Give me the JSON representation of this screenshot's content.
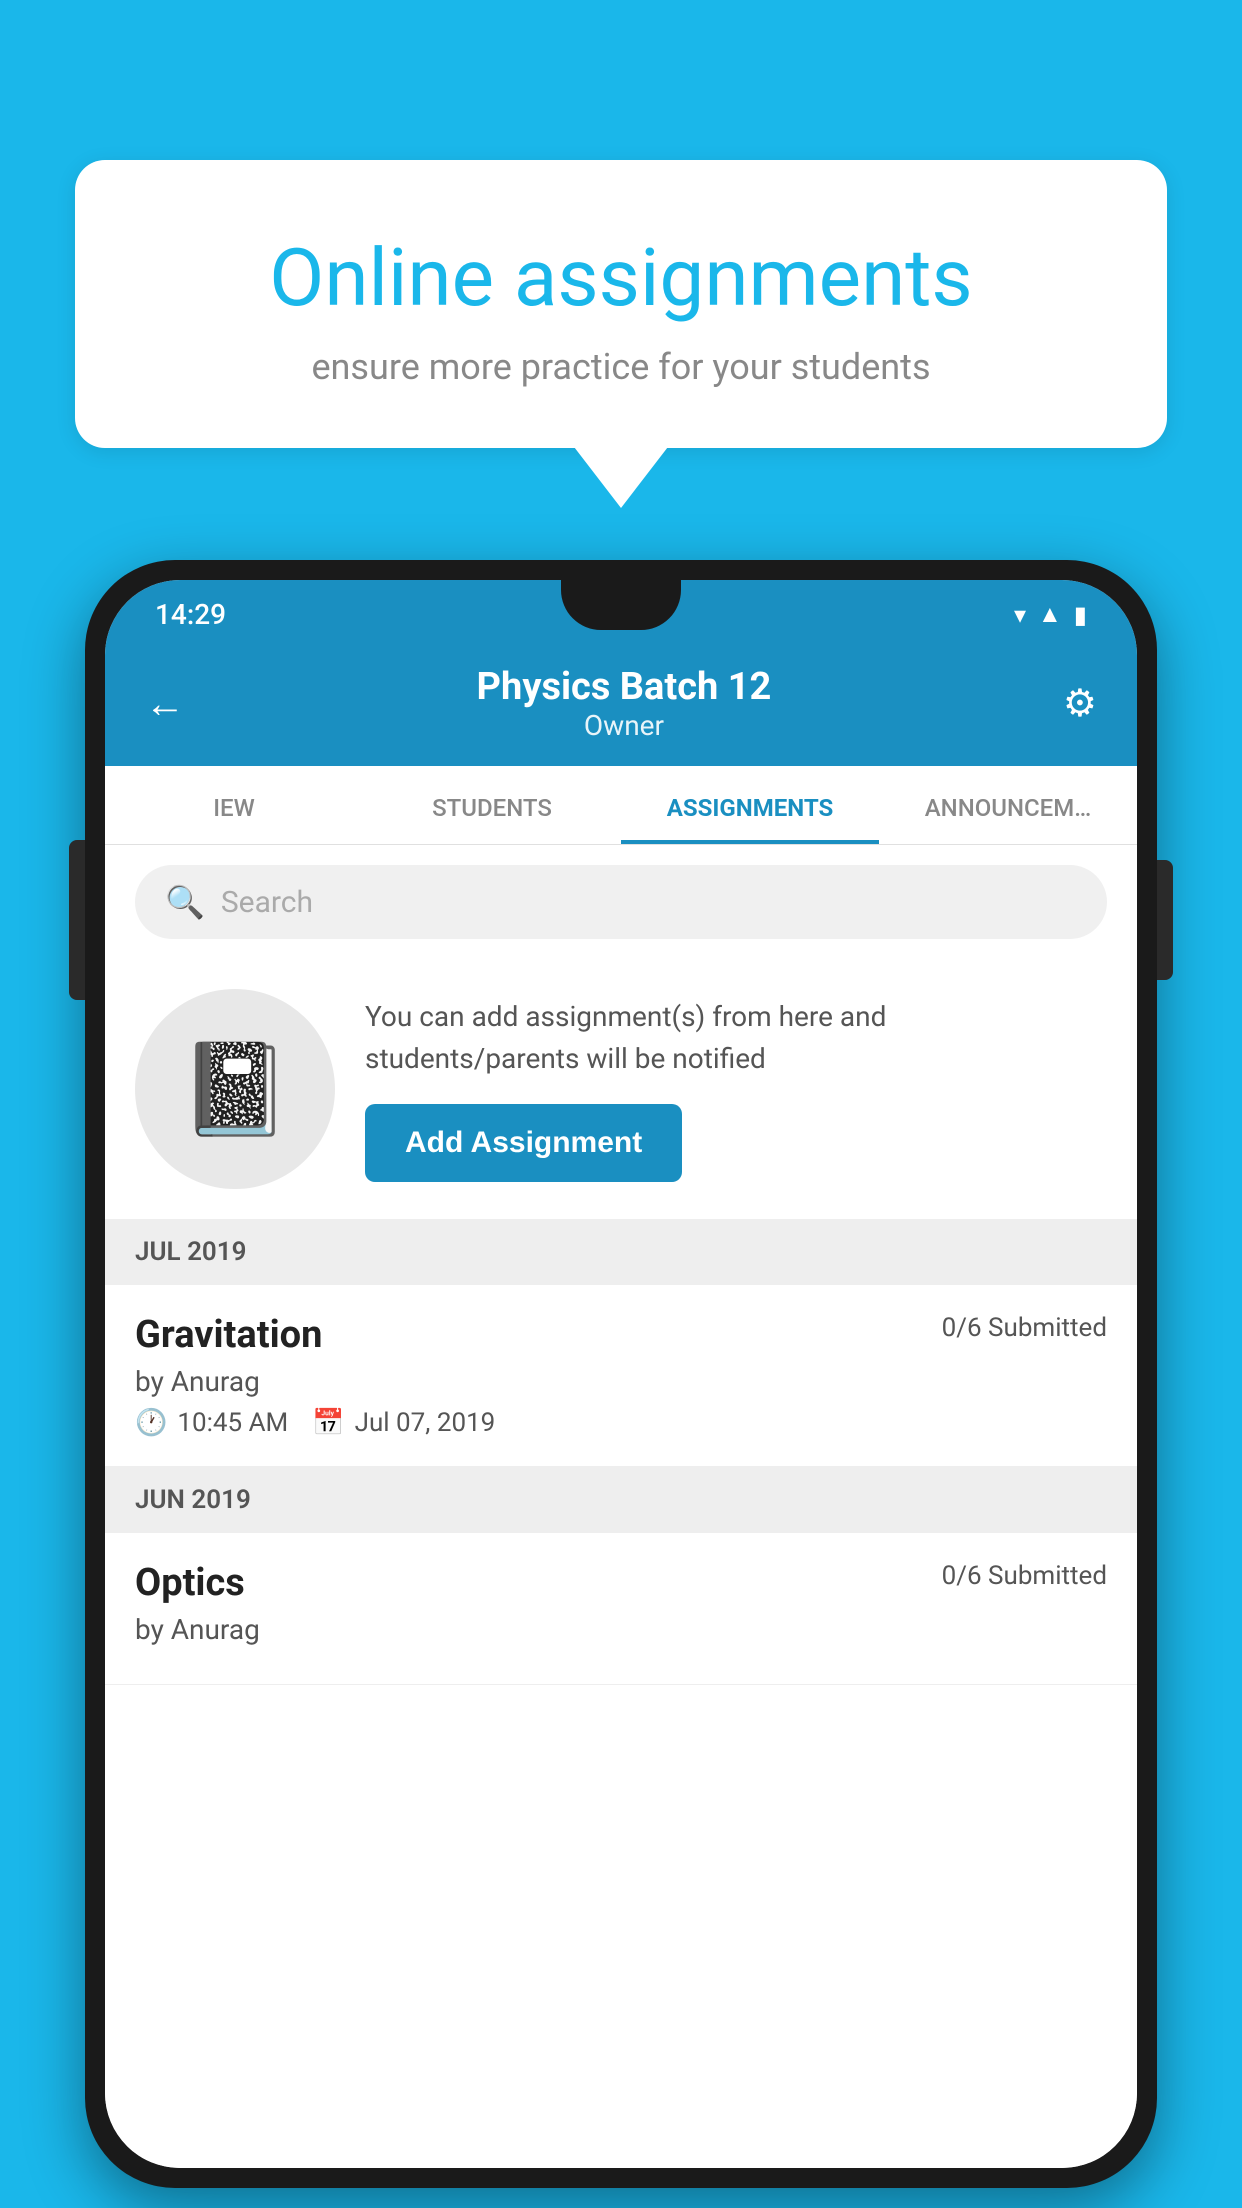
{
  "background": {
    "color": "#1ab7ea"
  },
  "speech_bubble": {
    "title": "Online assignments",
    "subtitle": "ensure more practice for your students"
  },
  "status_bar": {
    "time": "14:29",
    "icons": [
      "wifi",
      "signal",
      "battery"
    ]
  },
  "app_header": {
    "title": "Physics Batch 12",
    "subtitle": "Owner",
    "back_label": "←",
    "settings_label": "⚙"
  },
  "tabs": [
    {
      "id": "iew",
      "label": "IEW",
      "active": false
    },
    {
      "id": "students",
      "label": "STUDENTS",
      "active": false
    },
    {
      "id": "assignments",
      "label": "ASSIGNMENTS",
      "active": true
    },
    {
      "id": "announcements",
      "label": "ANNOUNCEM…",
      "active": false
    }
  ],
  "search": {
    "placeholder": "Search"
  },
  "promo": {
    "description": "You can add assignment(s) from here and students/parents will be notified",
    "button_label": "Add Assignment"
  },
  "sections": [
    {
      "header": "JUL 2019",
      "assignments": [
        {
          "name": "Gravitation",
          "submitted": "0/6 Submitted",
          "by": "by Anurag",
          "time": "10:45 AM",
          "date": "Jul 07, 2019"
        }
      ]
    },
    {
      "header": "JUN 2019",
      "assignments": [
        {
          "name": "Optics",
          "submitted": "0/6 Submitted",
          "by": "by Anurag",
          "time": "",
          "date": ""
        }
      ]
    }
  ]
}
